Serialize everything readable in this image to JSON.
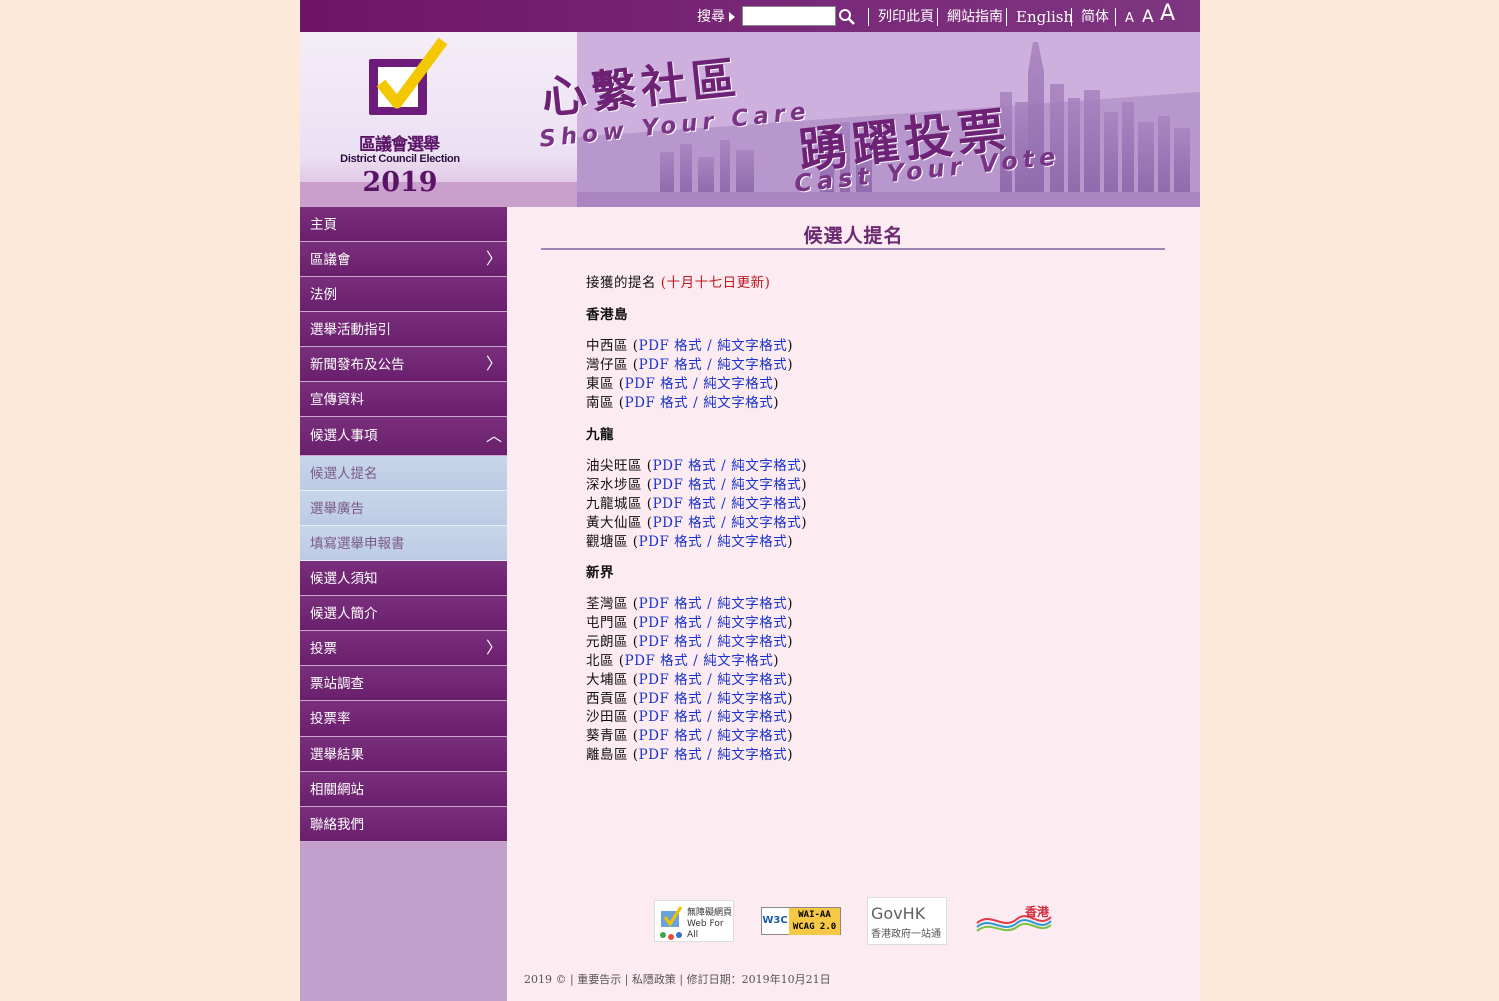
{
  "topbar": {
    "search_label": "搜尋",
    "search_value": "",
    "print_label": "列印此頁",
    "sitemap_label": "網站指南",
    "english_label": "English",
    "simplified_label": "简体",
    "font_small": "A",
    "font_medium": "A",
    "font_large": "A"
  },
  "banner": {
    "logo_title": "區議會選舉",
    "logo_subtitle": "District Council Election",
    "logo_year": "2019",
    "slogan1_cn": "心繫社區",
    "slogan1_en": "Show Your Care",
    "slogan2_cn": "踴躍投票",
    "slogan2_en": "Cast Your Vote"
  },
  "sidebar": {
    "items": [
      {
        "label": "主頁"
      },
      {
        "label": "區議會",
        "chevron": "〉"
      },
      {
        "label": "法例"
      },
      {
        "label": "選舉活動指引"
      },
      {
        "label": "新聞發布及公告",
        "chevron": "〉"
      },
      {
        "label": "宣傳資料"
      },
      {
        "label": "候選人事項",
        "chevron": "︿"
      },
      {
        "label": "候選人須知"
      },
      {
        "label": "候選人簡介"
      },
      {
        "label": "投票",
        "chevron": "〉"
      },
      {
        "label": "票站調查"
      },
      {
        "label": "投票率"
      },
      {
        "label": "選舉結果"
      },
      {
        "label": "相關網站"
      },
      {
        "label": "聯絡我們"
      }
    ],
    "sub_items": [
      {
        "label": "候選人提名"
      },
      {
        "label": "選舉廣告"
      },
      {
        "label": "填寫選舉申報書"
      }
    ]
  },
  "main": {
    "title": "候選人提名",
    "intro": "接獲的提名",
    "updated": "(十月十七日更新)",
    "pdf_label": "PDF 格式",
    "slash": "/",
    "text_label": "純文字格式",
    "regions": [
      {
        "name": "香港島",
        "districts": [
          {
            "name": "中西區"
          },
          {
            "name": "灣仔區"
          },
          {
            "name": "東區"
          },
          {
            "name": "南區"
          }
        ]
      },
      {
        "name": "九龍",
        "districts": [
          {
            "name": "油尖旺區"
          },
          {
            "name": "深水埗區"
          },
          {
            "name": "九龍城區"
          },
          {
            "name": "黃大仙區"
          },
          {
            "name": "觀塘區"
          }
        ]
      },
      {
        "name": "新界",
        "districts": [
          {
            "name": "荃灣區"
          },
          {
            "name": "屯門區"
          },
          {
            "name": "元朗區"
          },
          {
            "name": "北區"
          },
          {
            "name": "大埔區"
          },
          {
            "name": "西貢區"
          },
          {
            "name": "沙田區"
          },
          {
            "name": "葵青區"
          },
          {
            "name": "離島區"
          }
        ]
      }
    ]
  },
  "footer_logos": {
    "webforall": "無障礙網頁 Web For All",
    "wcag": "WAI-AA WCAG 2.0",
    "govhk_en": "GovHK",
    "govhk_cn": "香港政府一站通",
    "brandhk": "香港"
  },
  "footer": {
    "copyright": "2019 ©",
    "important_notices": "重要告示",
    "privacy": "私隱政策",
    "revised": "修訂日期：2019年10月21日"
  },
  "colors": {
    "topbar": "#6e1467",
    "nav": "#6a1f6d",
    "sub_nav": "#c3d2e8",
    "content_bg": "#fcebf0",
    "title": "#6a2970",
    "link": "#1a33cc",
    "updated": "#c0181f"
  }
}
